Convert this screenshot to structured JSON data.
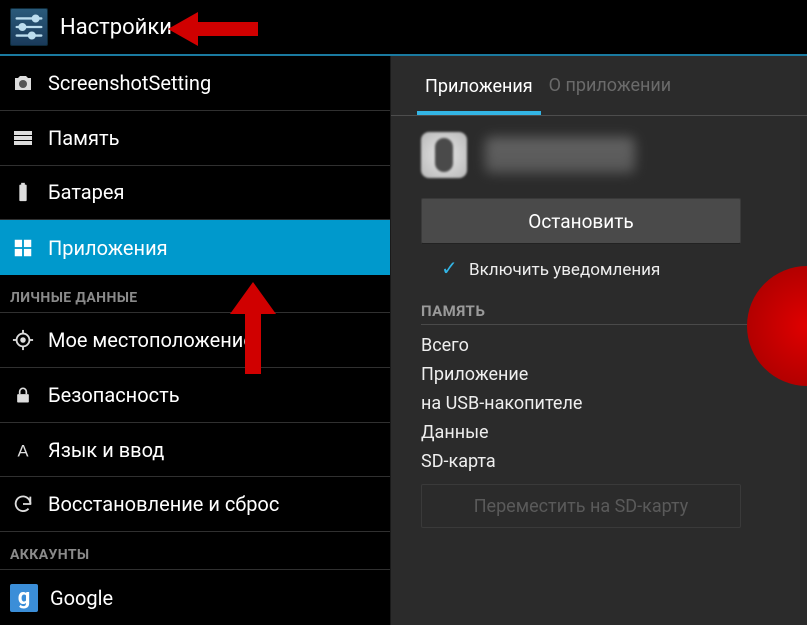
{
  "header": {
    "title": "Настройки"
  },
  "sidebar": {
    "items": [
      {
        "label": "ScreenshotSetting",
        "icon": "camera"
      },
      {
        "label": "Память",
        "icon": "storage"
      },
      {
        "label": "Батарея",
        "icon": "battery"
      },
      {
        "label": "Приложения",
        "icon": "apps",
        "selected": true
      }
    ],
    "section_personal": "ЛИЧНЫЕ ДАННЫЕ",
    "personal_items": [
      {
        "label": "Мое местоположение",
        "icon": "location"
      },
      {
        "label": "Безопасность",
        "icon": "lock"
      },
      {
        "label": "Язык и ввод",
        "icon": "language"
      },
      {
        "label": "Восстановление и сброс",
        "icon": "reset"
      }
    ],
    "section_accounts": "АККАУНТЫ",
    "account_items": [
      {
        "label": "Google",
        "icon": "google"
      }
    ]
  },
  "detail": {
    "tab_active": "Приложения",
    "tab_inactive": "О приложении",
    "stop_button": "Остановить",
    "notif_checkbox": "Включить уведомления",
    "notif_checked": true,
    "memory_section": "ПАМЯТЬ",
    "memory_rows": [
      "Всего",
      "Приложение",
      "на USB-накопителе",
      "Данные",
      "SD-карта"
    ],
    "move_button": "Переместить на SD-карту"
  }
}
